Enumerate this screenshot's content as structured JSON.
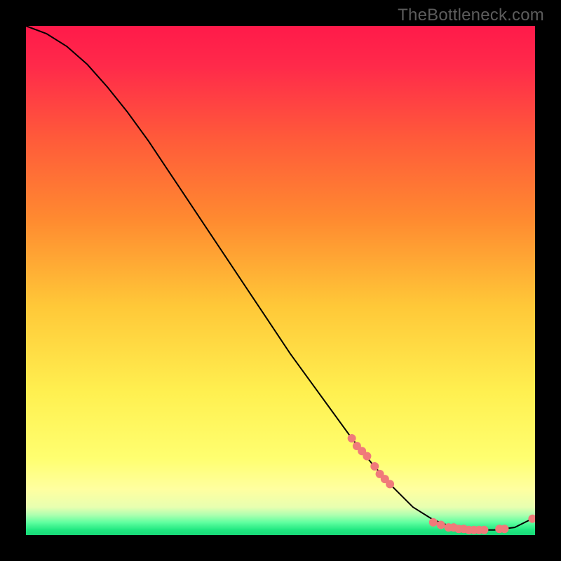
{
  "watermark": "TheBottleneck.com",
  "colors": {
    "gradient_top": "#ff1a4a",
    "gradient_mid": "#ffe84a",
    "gradient_bot_yellow": "#ffff8a",
    "gradient_bot_green": "#2aff8a",
    "curve": "#000000",
    "marker": "#f07a7a",
    "frame": "#000000"
  },
  "chart_data": {
    "type": "line",
    "title": "",
    "xlabel": "",
    "ylabel": "",
    "xlim": [
      0,
      100
    ],
    "ylim": [
      0,
      100
    ],
    "series": [
      {
        "name": "curve",
        "x": [
          0,
          4,
          8,
          12,
          16,
          20,
          24,
          28,
          32,
          36,
          40,
          44,
          48,
          52,
          56,
          60,
          64,
          68,
          72,
          76,
          80,
          84,
          88,
          92,
          96,
          100
        ],
        "y": [
          100,
          98.5,
          96,
          92.5,
          88,
          83,
          77.5,
          71.5,
          65.5,
          59.5,
          53.5,
          47.5,
          41.5,
          35.5,
          30,
          24.5,
          19,
          14,
          9.5,
          5.5,
          3,
          1.5,
          1,
          1,
          1.5,
          3.5
        ]
      }
    ],
    "markers": [
      {
        "x": 64,
        "y": 19
      },
      {
        "x": 65,
        "y": 17.5
      },
      {
        "x": 66,
        "y": 16.5
      },
      {
        "x": 67,
        "y": 15.5
      },
      {
        "x": 68.5,
        "y": 13.5
      },
      {
        "x": 69.5,
        "y": 12
      },
      {
        "x": 70.5,
        "y": 11
      },
      {
        "x": 71.5,
        "y": 10
      },
      {
        "x": 80,
        "y": 2.5
      },
      {
        "x": 81.5,
        "y": 2
      },
      {
        "x": 83,
        "y": 1.5
      },
      {
        "x": 84,
        "y": 1.5
      },
      {
        "x": 85,
        "y": 1.2
      },
      {
        "x": 86,
        "y": 1.2
      },
      {
        "x": 87,
        "y": 1
      },
      {
        "x": 88,
        "y": 1
      },
      {
        "x": 89,
        "y": 1
      },
      {
        "x": 90,
        "y": 1
      },
      {
        "x": 93,
        "y": 1.2
      },
      {
        "x": 94,
        "y": 1.2
      },
      {
        "x": 99.5,
        "y": 3.2
      }
    ]
  }
}
